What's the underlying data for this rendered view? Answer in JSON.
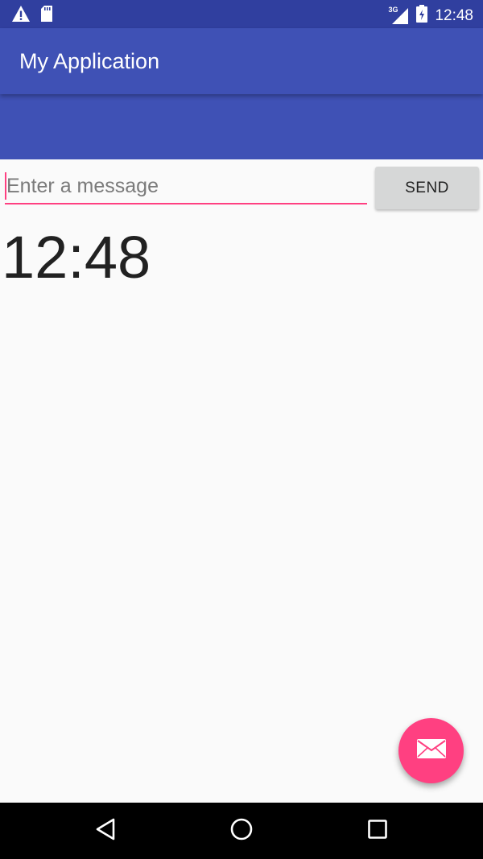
{
  "status_bar": {
    "time": "12:48",
    "network_label": "3G",
    "icons": [
      "warning-icon",
      "sd-card-icon",
      "signal-icon",
      "battery-icon"
    ]
  },
  "app_bar": {
    "title": "My Application"
  },
  "message": {
    "placeholder": "Enter a message",
    "value": "",
    "send_label": "SEND"
  },
  "content": {
    "clock": "12:48"
  },
  "fab": {
    "icon": "mail-icon"
  },
  "nav_bar": {
    "icons": [
      "back-icon",
      "home-icon",
      "recents-icon"
    ]
  },
  "colors": {
    "primary": "#3f51b5",
    "primary_dark": "#303f9f",
    "accent": "#ff4081",
    "background": "#fafafa"
  }
}
